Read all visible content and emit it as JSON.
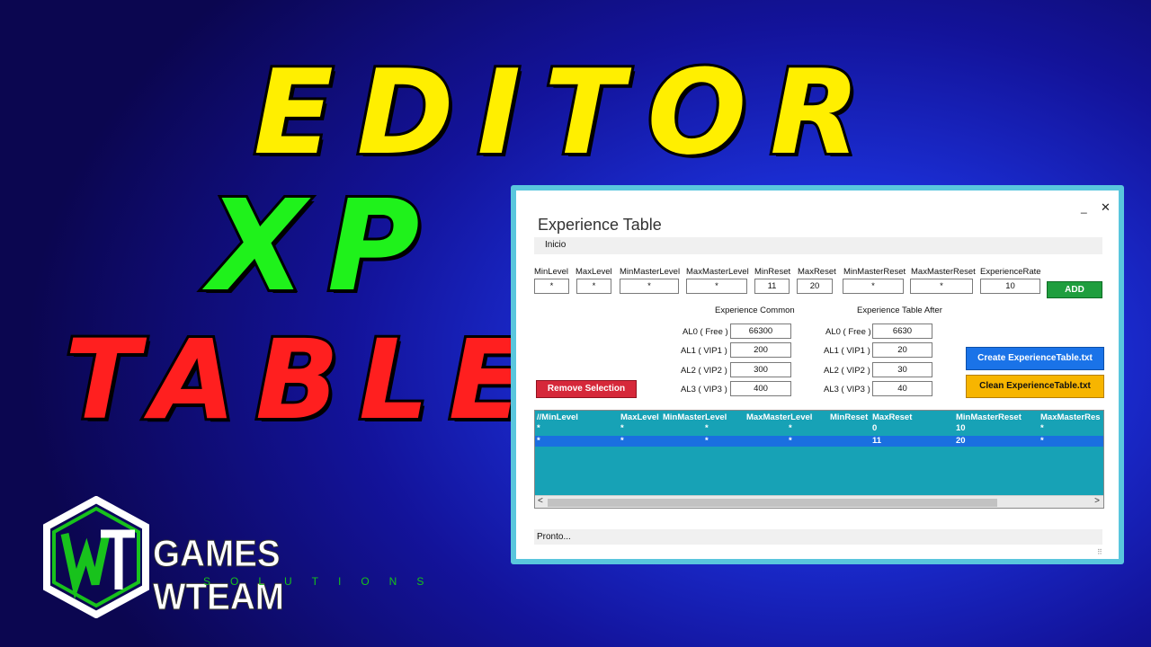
{
  "headline": {
    "line1": "EDITOR",
    "line2": "XP",
    "line3": "TABLE"
  },
  "logo": {
    "mark": "WT",
    "name": "GAMES WTEAM",
    "sub": "SOLUTIONS"
  },
  "window": {
    "title": "Experience Table",
    "minimize": "_",
    "close": "✕",
    "menu": [
      "Inicio"
    ],
    "fields": [
      {
        "label": "MinLevel",
        "value": "*"
      },
      {
        "label": "MaxLevel",
        "value": "*"
      },
      {
        "label": "MinMasterLevel",
        "value": "*"
      },
      {
        "label": "MaxMasterLevel",
        "value": "*"
      },
      {
        "label": "MinReset",
        "value": "11"
      },
      {
        "label": "MaxReset",
        "value": "20"
      },
      {
        "label": "MinMasterReset",
        "value": "*"
      },
      {
        "label": "MaxMasterReset",
        "value": "*"
      },
      {
        "label": "ExperienceRate",
        "value": "10"
      }
    ],
    "add_label": "ADD",
    "common": {
      "title": "Experience Common",
      "rows": [
        {
          "label": "AL0 ( Free )",
          "value": "66300"
        },
        {
          "label": "AL1 ( VIP1 )",
          "value": "200"
        },
        {
          "label": "AL2 ( VIP2 )",
          "value": "300"
        },
        {
          "label": "AL3 ( VIP3 )",
          "value": "400"
        }
      ]
    },
    "after": {
      "title": "Experience Table After",
      "rows": [
        {
          "label": "AL0 ( Free )",
          "value": "6630"
        },
        {
          "label": "AL1 ( VIP1 )",
          "value": "20"
        },
        {
          "label": "AL2 ( VIP2 )",
          "value": "30"
        },
        {
          "label": "AL3 ( VIP3 )",
          "value": "40"
        }
      ]
    },
    "remove_label": "Remove Selection",
    "create_label": "Create ExperienceTable.txt",
    "clean_label": "Clean ExperienceTable.txt",
    "grid": {
      "headers": [
        "//MinLevel",
        "MaxLevel",
        "MinMasterLevel",
        "MaxMasterLevel",
        "MinReset",
        "MaxReset",
        "MinMasterReset",
        "MaxMasterRes"
      ],
      "rows": [
        [
          "*",
          "*",
          "*",
          "*",
          "0",
          "10",
          "*"
        ],
        [
          "*",
          "*",
          "*",
          "*",
          "11",
          "20",
          "*"
        ]
      ]
    },
    "status": "Pronto..."
  }
}
